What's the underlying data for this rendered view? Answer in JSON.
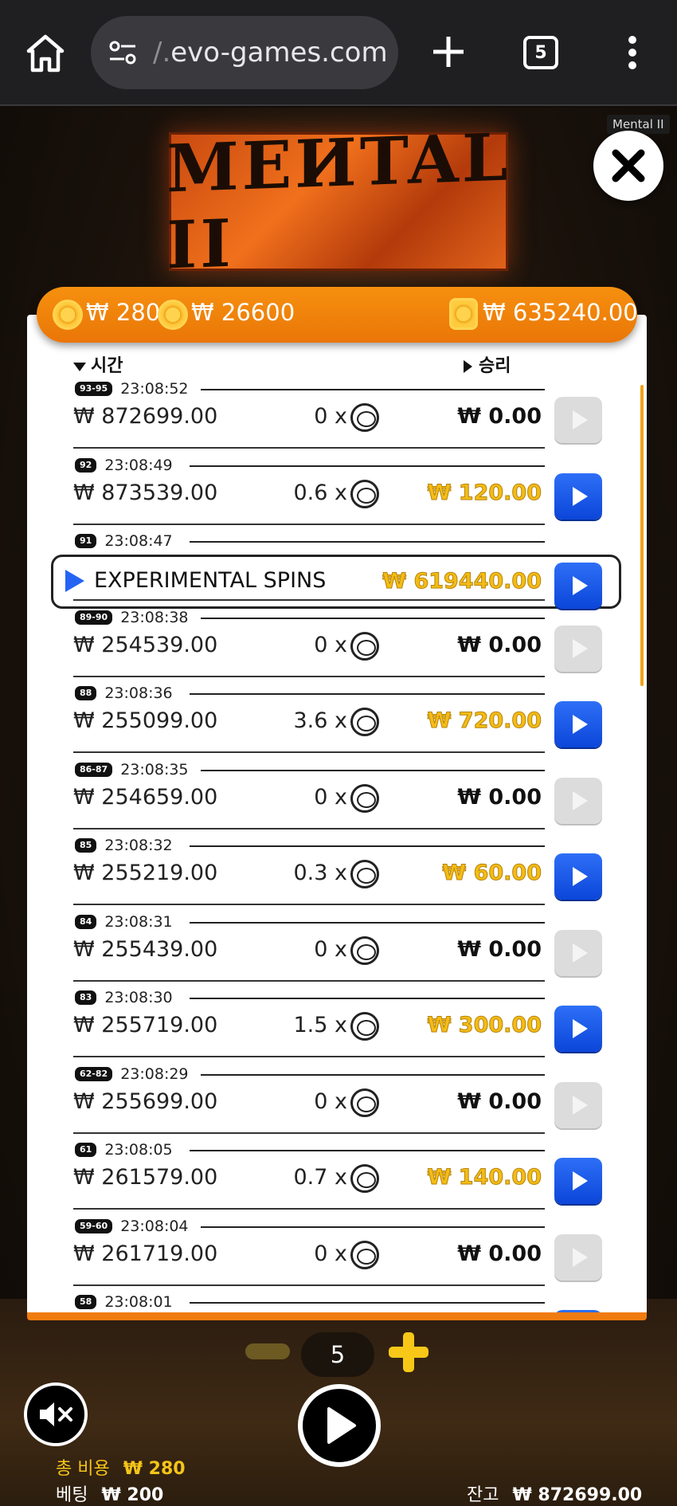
{
  "browser": {
    "url": "evo-games.com",
    "url_prefix": "/.",
    "tab_count": "5"
  },
  "game": {
    "tooltip": "Mental II",
    "logo_text": "MEИTAL II"
  },
  "balance_bar": {
    "cost": "₩ 280",
    "bet_total": "₩ 26600",
    "wallet": "₩ 635240.00"
  },
  "history": {
    "col_time": "시간",
    "col_win": "승리",
    "rows": [
      {
        "tag": "93-95",
        "time": "23:08:52",
        "balance": "₩ 872699.00",
        "mult": "0 x",
        "win": "₩ 0.00",
        "gold": false,
        "active": false
      },
      {
        "tag": "92",
        "time": "23:08:49",
        "balance": "₩ 873539.00",
        "mult": "0.6 x",
        "win": "₩ 120.00",
        "gold": true,
        "active": true
      },
      {
        "tag": "91",
        "time": "23:08:47",
        "feature_label": "EXPERIMENTAL SPINS",
        "win": "₩ 619440.00",
        "gold": true,
        "active": true,
        "feature": true
      },
      {
        "tag": "89-90",
        "time": "23:08:38",
        "balance": "₩ 254539.00",
        "mult": "0 x",
        "win": "₩ 0.00",
        "gold": false,
        "active": false
      },
      {
        "tag": "88",
        "time": "23:08:36",
        "balance": "₩ 255099.00",
        "mult": "3.6 x",
        "win": "₩ 720.00",
        "gold": true,
        "active": true
      },
      {
        "tag": "86-87",
        "time": "23:08:35",
        "balance": "₩ 254659.00",
        "mult": "0 x",
        "win": "₩ 0.00",
        "gold": false,
        "active": false
      },
      {
        "tag": "85",
        "time": "23:08:32",
        "balance": "₩ 255219.00",
        "mult": "0.3 x",
        "win": "₩ 60.00",
        "gold": true,
        "active": true
      },
      {
        "tag": "84",
        "time": "23:08:31",
        "balance": "₩ 255439.00",
        "mult": "0 x",
        "win": "₩ 0.00",
        "gold": false,
        "active": false
      },
      {
        "tag": "83",
        "time": "23:08:30",
        "balance": "₩ 255719.00",
        "mult": "1.5 x",
        "win": "₩ 300.00",
        "gold": true,
        "active": true
      },
      {
        "tag": "62-82",
        "time": "23:08:29",
        "balance": "₩ 255699.00",
        "mult": "0 x",
        "win": "₩ 0.00",
        "gold": false,
        "active": false
      },
      {
        "tag": "61",
        "time": "23:08:05",
        "balance": "₩ 261579.00",
        "mult": "0.7 x",
        "win": "₩ 140.00",
        "gold": true,
        "active": true
      },
      {
        "tag": "59-60",
        "time": "23:08:04",
        "balance": "₩ 261719.00",
        "mult": "0 x",
        "win": "₩ 0.00",
        "gold": false,
        "active": false
      },
      {
        "tag": "58",
        "time": "23:08:01",
        "balance": "",
        "mult": "",
        "win": "",
        "gold": false,
        "active": true,
        "partial": true
      }
    ]
  },
  "controls": {
    "bet_level": "5",
    "total_cost_label": "총 비용",
    "total_cost": "₩ 280",
    "bet_label": "베팅",
    "bet": "₩ 200",
    "balance_label": "잔고",
    "balance": "₩ 872699.00"
  },
  "colors": {
    "accent_orange": "#f07c10",
    "gold_win": "#f4bc15",
    "play_blue": "#0b46d9"
  }
}
